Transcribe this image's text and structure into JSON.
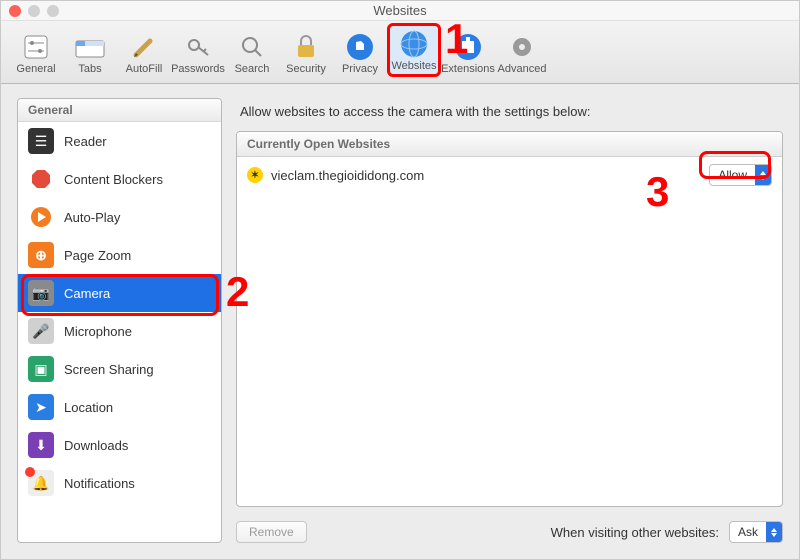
{
  "window": {
    "title": "Websites"
  },
  "toolbar": {
    "items": [
      {
        "label": "General"
      },
      {
        "label": "Tabs"
      },
      {
        "label": "AutoFill"
      },
      {
        "label": "Passwords"
      },
      {
        "label": "Search"
      },
      {
        "label": "Security"
      },
      {
        "label": "Privacy"
      },
      {
        "label": "Websites"
      },
      {
        "label": "Extensions"
      },
      {
        "label": "Advanced"
      }
    ],
    "selected_index": 7
  },
  "sidebar": {
    "header": "General",
    "items": [
      {
        "label": "Reader"
      },
      {
        "label": "Content Blockers"
      },
      {
        "label": "Auto-Play"
      },
      {
        "label": "Page Zoom"
      },
      {
        "label": "Camera"
      },
      {
        "label": "Microphone"
      },
      {
        "label": "Screen Sharing"
      },
      {
        "label": "Location"
      },
      {
        "label": "Downloads"
      },
      {
        "label": "Notifications"
      }
    ],
    "selected_index": 4
  },
  "main": {
    "description": "Allow websites to access the camera with the settings below:",
    "list_header": "Currently Open Websites",
    "rows": [
      {
        "site": "vieclam.thegioididong.com",
        "permission": "Allow"
      }
    ],
    "remove_label": "Remove",
    "other_label": "When visiting other websites:",
    "other_value": "Ask"
  },
  "annotations": {
    "n1": "1",
    "n2": "2",
    "n3": "3"
  }
}
